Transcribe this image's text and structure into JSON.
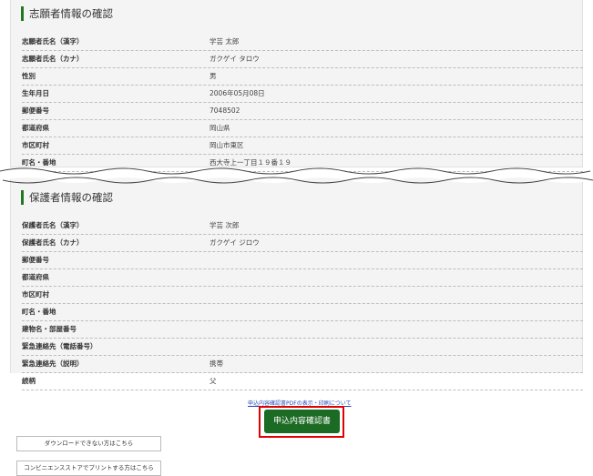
{
  "applicant": {
    "title": "志願者情報の確認",
    "rows": [
      {
        "label": "志願者氏名（漢字）",
        "value": "学芸 太郎"
      },
      {
        "label": "志願者氏名（カナ）",
        "value": "ガクゲイ タロウ"
      },
      {
        "label": "性別",
        "value": "男"
      },
      {
        "label": "生年月日",
        "value": "2006年05月08日"
      },
      {
        "label": "郵便番号",
        "value": "7048502"
      },
      {
        "label": "都道府県",
        "value": "岡山県"
      },
      {
        "label": "市区町村",
        "value": "岡山市東区"
      },
      {
        "label": "町名・番地",
        "value": "西大寺上一丁目１９番１９"
      }
    ]
  },
  "guardian": {
    "title": "保護者情報の確認",
    "rows": [
      {
        "label": "保護者氏名（漢字）",
        "value": "学芸 次郎"
      },
      {
        "label": "保護者氏名（カナ）",
        "value": "ガクゲイ ジロウ"
      },
      {
        "label": "郵便番号",
        "value": ""
      },
      {
        "label": "都道府県",
        "value": ""
      },
      {
        "label": "市区町村",
        "value": ""
      },
      {
        "label": "町名・番地",
        "value": ""
      },
      {
        "label": "建物名・部屋番号",
        "value": ""
      },
      {
        "label": "緊急連絡先（電話番号）",
        "value": ""
      },
      {
        "label": "緊急連絡先（説明）",
        "value": "携帯"
      },
      {
        "label": "続柄",
        "value": "父"
      }
    ]
  },
  "actions": {
    "note_link": "申込内容確認書PDFの表示・印刷について",
    "confirm_button": "申込内容確認書",
    "download_help": "ダウンロードできない方はこちら",
    "convenience_print": "コンビニエンスストアでプリントする方はこちら"
  },
  "colors": {
    "accent_green": "#1c6b24",
    "highlight_red": "#e00000",
    "panel_bg": "#f4f4f4"
  }
}
